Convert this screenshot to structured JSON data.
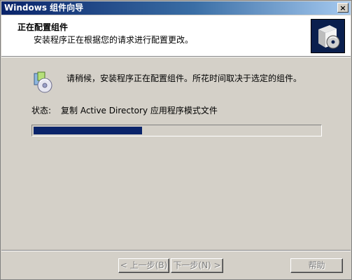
{
  "window": {
    "title": "Windows 组件向导",
    "close_label": "×"
  },
  "header": {
    "title": "正在配置组件",
    "subtitle": "安装程序正在根据您的请求进行配置更改。",
    "icon": "wizard-box-cd-icon"
  },
  "body": {
    "info_text": "请稍候，安装程序正在配置组件。所花时间取决于选定的组件。",
    "info_icon": "components-install-icon",
    "status_label": "状态:",
    "status_value": "复制 Active Directory 应用程序模式文件",
    "progress_fraction": 0.38
  },
  "buttons": {
    "back": "< 上一步(B)",
    "next": "下一步(N) >",
    "help": "帮助"
  },
  "colors": {
    "titlebar": "#0a246a",
    "progress": "#0a246a",
    "face": "#d4d0c8"
  }
}
